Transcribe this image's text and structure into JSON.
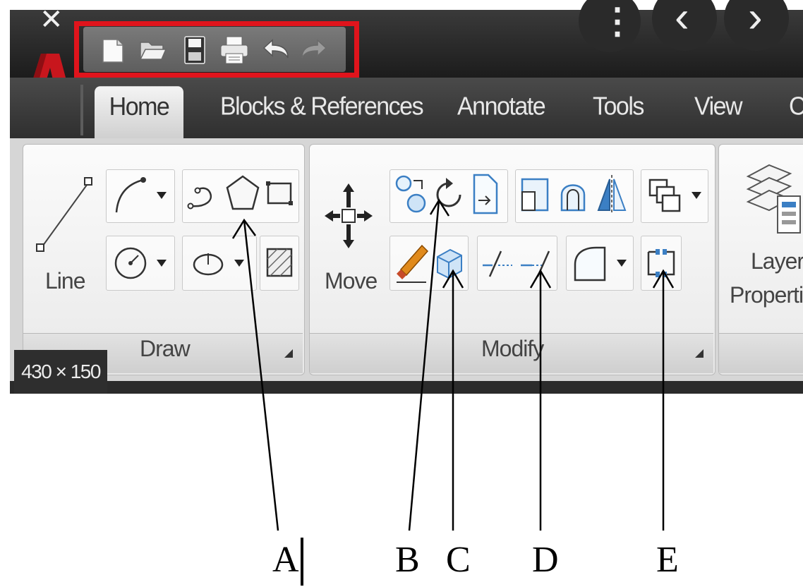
{
  "window": {
    "close_glyph": "✕",
    "more_glyph": "⋮",
    "back_glyph": "‹",
    "forward_glyph": "›"
  },
  "app_menu": {
    "logo_letter": "A"
  },
  "highlight_color": "#e0141c",
  "ribbon": {
    "tabs": [
      "Home",
      "Blocks & References",
      "Annotate",
      "Tools",
      "View",
      "C"
    ],
    "active_tab": "Home",
    "panels": {
      "draw": {
        "title": "Draw",
        "line_label": "Line"
      },
      "modify": {
        "title": "Modify",
        "move_label": "Move"
      },
      "layers": {
        "label_line1": "Layer",
        "label_line2": "Properti"
      }
    }
  },
  "size_badge": "430 × 150",
  "callouts": [
    "A",
    "B",
    "C",
    "D",
    "E"
  ],
  "quick_access_icons": [
    "new-icon",
    "open-icon",
    "save-icon",
    "print-icon",
    "undo-icon",
    "redo-icon"
  ]
}
